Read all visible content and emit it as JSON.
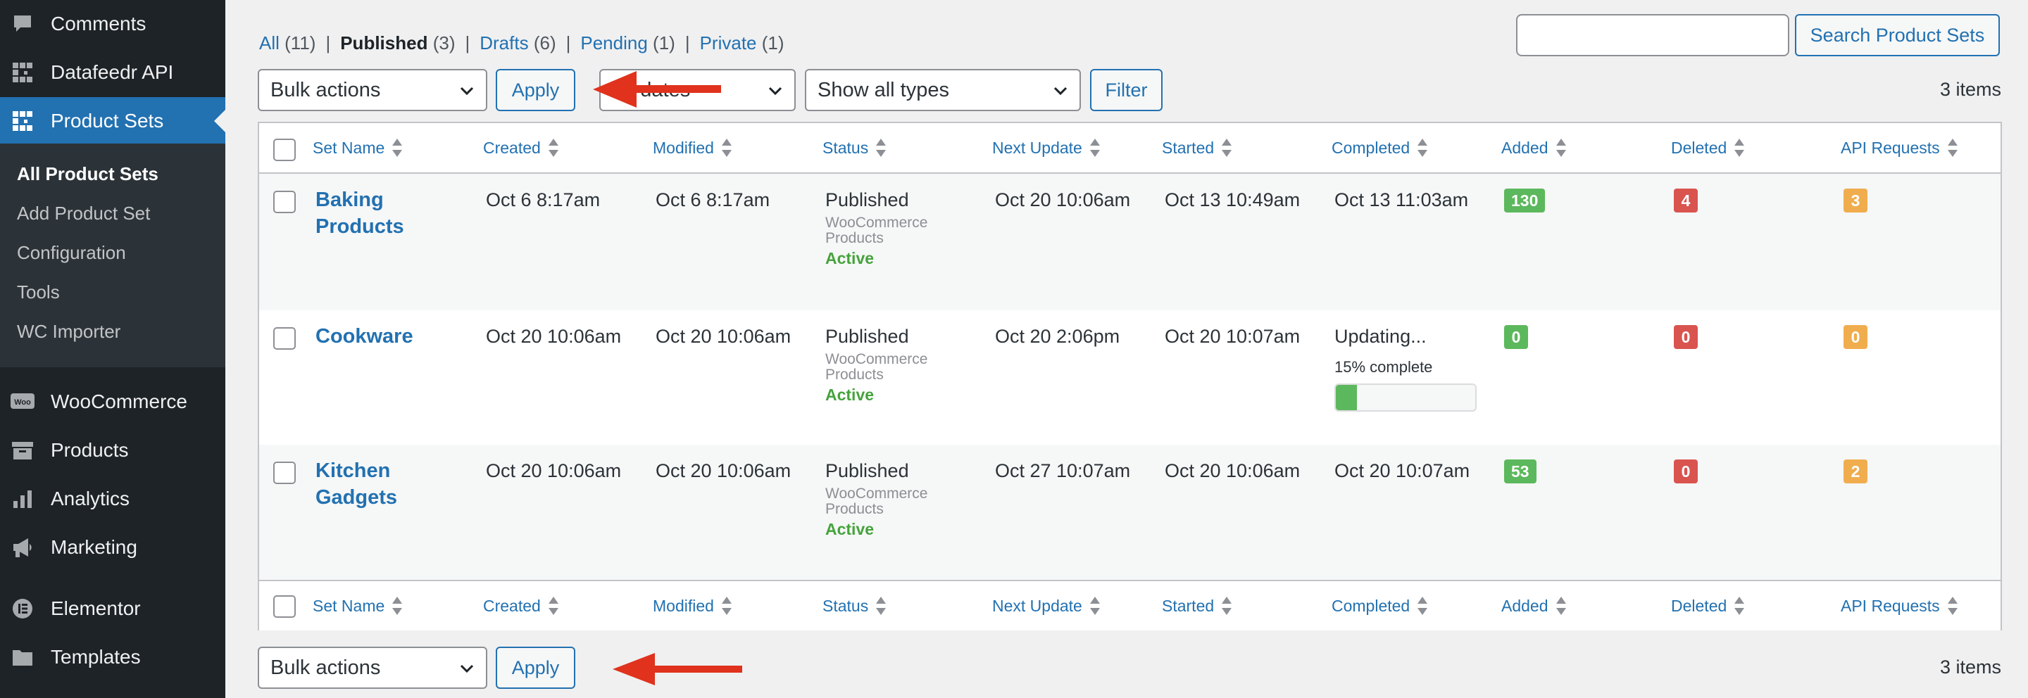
{
  "sidebar": {
    "menu": [
      {
        "label": "Comments",
        "icon": "comment-icon"
      },
      {
        "label": "Datafeedr API",
        "icon": "datafeedr-icon"
      },
      {
        "label": "Product Sets",
        "icon": "datafeedr-icon",
        "current": true
      },
      {
        "label": "WooCommerce",
        "icon": "woo-icon"
      },
      {
        "label": "Products",
        "icon": "archive-icon"
      },
      {
        "label": "Analytics",
        "icon": "bar-chart-icon"
      },
      {
        "label": "Marketing",
        "icon": "megaphone-icon"
      },
      {
        "label": "Elementor",
        "icon": "elementor-icon"
      },
      {
        "label": "Templates",
        "icon": "folder-icon"
      }
    ],
    "submenu": [
      {
        "label": "All Product Sets",
        "current": true
      },
      {
        "label": "Add Product Set"
      },
      {
        "label": "Configuration"
      },
      {
        "label": "Tools"
      },
      {
        "label": "WC Importer"
      }
    ]
  },
  "views": [
    {
      "label": "All",
      "count": "(11)",
      "current": false
    },
    {
      "label": "Published",
      "count": "(3)",
      "current": true
    },
    {
      "label": "Drafts",
      "count": "(6)",
      "current": false
    },
    {
      "label": "Pending",
      "count": "(1)",
      "current": false
    },
    {
      "label": "Private",
      "count": "(1)",
      "current": false
    }
  ],
  "views_separator": "|",
  "search": {
    "placeholder": "",
    "button": "Search Product Sets"
  },
  "top_nav": {
    "bulk_actions": "Bulk actions",
    "apply": "Apply",
    "dates": "All dates",
    "types": "Show all types",
    "filter": "Filter",
    "items": "3 items"
  },
  "bottom_nav": {
    "bulk_actions": "Bulk actions",
    "apply": "Apply",
    "items": "3 items"
  },
  "columns": [
    "Set Name",
    "Created",
    "Modified",
    "Status",
    "Next Update",
    "Started",
    "Completed",
    "Added",
    "Deleted",
    "API Requests"
  ],
  "rows": [
    {
      "name": "Baking Products",
      "created": "Oct 6 8:17am",
      "modified": "Oct 6 8:17am",
      "status": "Published",
      "status_type": "WooCommerce Products",
      "status_state": "Active",
      "next_update": "Oct 20 10:06am",
      "started": "Oct 13 10:49am",
      "completed": "Oct 13 11:03am",
      "added": "130",
      "deleted": "4",
      "api_requests": "3"
    },
    {
      "name": "Cookware",
      "created": "Oct 20 10:06am",
      "modified": "Oct 20 10:06am",
      "status": "Published",
      "status_type": "WooCommerce Products",
      "status_state": "Active",
      "next_update": "Oct 20 2:06pm",
      "started": "Oct 20 10:07am",
      "completed": "Updating...",
      "progress_text": "15% complete",
      "progress": 0.15,
      "added": "0",
      "deleted": "0",
      "api_requests": "0"
    },
    {
      "name": "Kitchen Gadgets",
      "created": "Oct 20 10:06am",
      "modified": "Oct 20 10:06am",
      "status": "Published",
      "status_type": "WooCommerce Products",
      "status_state": "Active",
      "next_update": "Oct 27 10:07am",
      "started": "Oct 20 10:06am",
      "completed": "Oct 20 10:07am",
      "added": "53",
      "deleted": "0",
      "api_requests": "2"
    }
  ],
  "colors": {
    "sidebar_bg": "#1d2327",
    "submenu_bg": "#2c3338",
    "accent": "#2271b1",
    "added_badge": "#5cb85c",
    "deleted_badge": "#d9534f",
    "api_badge": "#f0ad4e",
    "active_status": "#46a33d",
    "annotation_arrow": "#e0321c"
  }
}
